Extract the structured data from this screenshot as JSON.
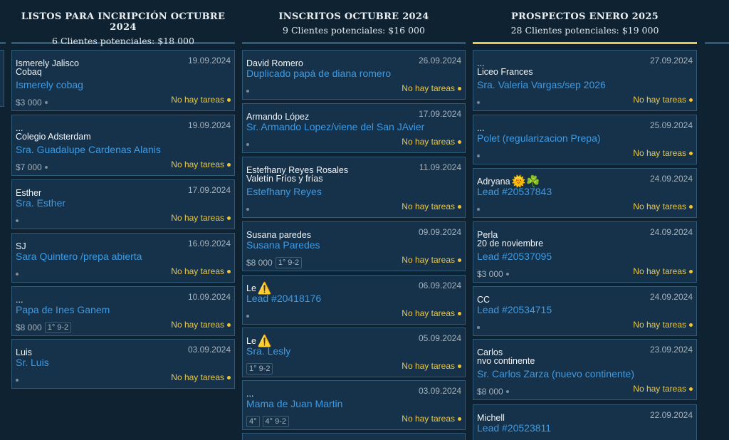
{
  "columns": [
    {
      "title": "LISTOS PARA INCRIPCIÓN OCTUBRE 2024",
      "subtitle": "6 Clientes potenciales: $18 000",
      "accent": "#2a5a78",
      "cards": [
        {
          "name": "Ismerely Jalisco",
          "line2": "Cobaq",
          "date": "19.09.2024",
          "link": "Ismerely cobag",
          "price": "$3 000",
          "tags": [],
          "tasks": "No hay tareas"
        },
        {
          "name": "...",
          "line2": "Colegio Adsterdam",
          "date": "19.09.2024",
          "link": "Sra. Guadalupe Cardenas Alanis",
          "price": "$7 000",
          "tags": [],
          "tasks": "No hay tareas"
        },
        {
          "name": "Esther",
          "line2": "",
          "date": "17.09.2024",
          "link": "Sra. Esther",
          "price": "",
          "tags": [],
          "tasks": "No hay tareas"
        },
        {
          "name": "SJ",
          "line2": "",
          "date": "16.09.2024",
          "link": "Sara Quintero /prepa abierta",
          "price": "",
          "tags": [],
          "tasks": "No hay tareas"
        },
        {
          "name": "...",
          "line2": "",
          "date": "10.09.2024",
          "link": "Papa de Ines Ganem",
          "price": "$8 000",
          "tags": [
            "1° 9-2"
          ],
          "tasks": "No hay tareas"
        },
        {
          "name": "Luis",
          "line2": "",
          "date": "03.09.2024",
          "link": "Sr. Luis",
          "price": "",
          "tags": [],
          "tasks": "No hay tareas"
        }
      ]
    },
    {
      "title": "INSCRITOS OCTUBRE 2024",
      "subtitle": "9 Clientes potenciales: $16 000",
      "accent": "#2a5a78",
      "cards": [
        {
          "name": "David Romero",
          "line2": "",
          "date": "26.09.2024",
          "link": "Duplicado papá de diana romero",
          "price": "",
          "tags": [],
          "tasks": "No hay tareas"
        },
        {
          "name": "Armando López",
          "line2": "",
          "date": "17.09.2024",
          "link": "Sr. Armando Lopez/viene del San JAvier",
          "price": "",
          "tags": [],
          "tasks": "No hay tareas"
        },
        {
          "name": "Estefhany Reyes Rosales",
          "line2": "Valetín Fríos y frías",
          "date": "11.09.2024",
          "link": "Estefhany Reyes",
          "price": "",
          "tags": [],
          "tasks": "No hay tareas"
        },
        {
          "name": "Susana paredes",
          "line2": "",
          "date": "09.09.2024",
          "link": "Susana Paredes",
          "price": "$8 000",
          "tags": [
            "1° 9-2"
          ],
          "tasks": "No hay tareas"
        },
        {
          "name": "Le",
          "emoji": "⚠️",
          "line2": "",
          "date": "06.09.2024",
          "link": "Lead #20418176",
          "price": "",
          "tags": [],
          "tasks": "No hay tareas"
        },
        {
          "name": "Le",
          "emoji": "⚠️",
          "line2": "",
          "date": "05.09.2024",
          "link": "Sra. Lesly",
          "price": "",
          "tags": [
            "1° 9-2"
          ],
          "tasks": "No hay tareas"
        },
        {
          "name": "...",
          "line2": "",
          "date": "03.09.2024",
          "link": "Mama de Juan Martin",
          "price": "",
          "tags": [
            "4°",
            "4° 9-2"
          ],
          "tasks": "No hay tareas"
        }
      ]
    },
    {
      "title": "PROSPECTOS ENERO 2025",
      "subtitle": "28 Clientes potenciales: $19 000",
      "accent": "#e8c84e",
      "cards": [
        {
          "name": "...",
          "line2": "Liceo Frances",
          "date": "27.09.2024",
          "link": "Sra. Valeria Vargas/sep 2026",
          "price": "",
          "tags": [],
          "tasks": "No hay tareas"
        },
        {
          "name": "...",
          "line2": "",
          "date": "25.09.2024",
          "link": "Polet (regularizacion Prepa)",
          "price": "",
          "tags": [],
          "tasks": "No hay tareas"
        },
        {
          "name": "Adryana",
          "emoji": "🌞☘️",
          "line2": "",
          "date": "24.09.2024",
          "link": "Lead #20537843",
          "price": "",
          "tags": [],
          "tasks": "No hay tareas"
        },
        {
          "name": "Perla",
          "line2": "20 de noviembre",
          "date": "24.09.2024",
          "link": "Lead #20537095",
          "price": "$3 000",
          "tags": [],
          "tasks": "No hay tareas"
        },
        {
          "name": "CC",
          "line2": "",
          "date": "24.09.2024",
          "link": "Lead #20534715",
          "price": "",
          "tags": [],
          "tasks": "No hay tareas"
        },
        {
          "name": "Carlos",
          "line2": "nvo continente",
          "date": "23.09.2024",
          "link": "Sr. Carlos Zarza (nuevo continente)",
          "price": "$8 000",
          "tags": [],
          "tasks": "No hay tareas"
        },
        {
          "name": "Michell",
          "line2": "",
          "date": "22.09.2024",
          "link": "Lead #20523811",
          "price": "",
          "tags": [],
          "tasks": "No hay tareas"
        }
      ]
    }
  ]
}
